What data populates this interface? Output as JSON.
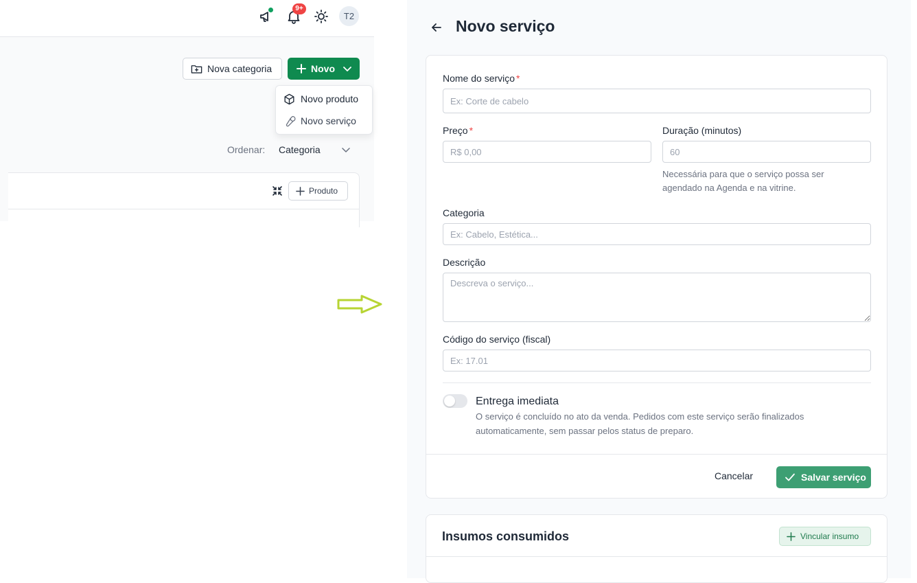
{
  "header": {
    "notification_badge": "9+",
    "avatar_initials": "T2"
  },
  "toolbar": {
    "new_category_label": "Nova categoria",
    "new_label": "Novo"
  },
  "new_menu": {
    "items": [
      {
        "label": "Novo produto",
        "icon": "box-icon"
      },
      {
        "label": "Novo serviço",
        "icon": "wrench-icon"
      }
    ]
  },
  "sort": {
    "label": "Ordenar:",
    "value": "Categoria"
  },
  "category_card": {
    "add_product_label": "Produto"
  },
  "form": {
    "title": "Novo serviço",
    "name_label": "Nome do serviço",
    "name_placeholder": "Ex: Corte de cabelo",
    "price_label": "Preço",
    "price_placeholder": "R$ 0,00",
    "duration_label": "Duração (minutos)",
    "duration_placeholder": "60",
    "duration_hint": "Necessária para que o serviço possa ser agendado na Agenda e na vitrine.",
    "category_label": "Categoria",
    "category_placeholder": "Ex: Cabelo, Estética...",
    "description_label": "Descrição",
    "description_placeholder": "Descreva o serviço...",
    "code_label": "Código do serviço (fiscal)",
    "code_placeholder": "Ex: 17.01",
    "required_mark": "*",
    "immediate_title": "Entrega imediata",
    "immediate_desc": "O serviço é concluído no ato da venda. Pedidos com este serviço serão finalizados automaticamente, sem passar pelos status de preparo.",
    "immediate_enabled": false,
    "cancel_label": "Cancelar",
    "save_label": "Salvar serviço"
  },
  "insumos": {
    "title": "Insumos consumidos",
    "link_label": "Vincular insumo"
  },
  "colors": {
    "primary": "#0f8a4f",
    "save": "#3d9f73",
    "required": "#ef4444",
    "arrow": "#b7d433"
  }
}
